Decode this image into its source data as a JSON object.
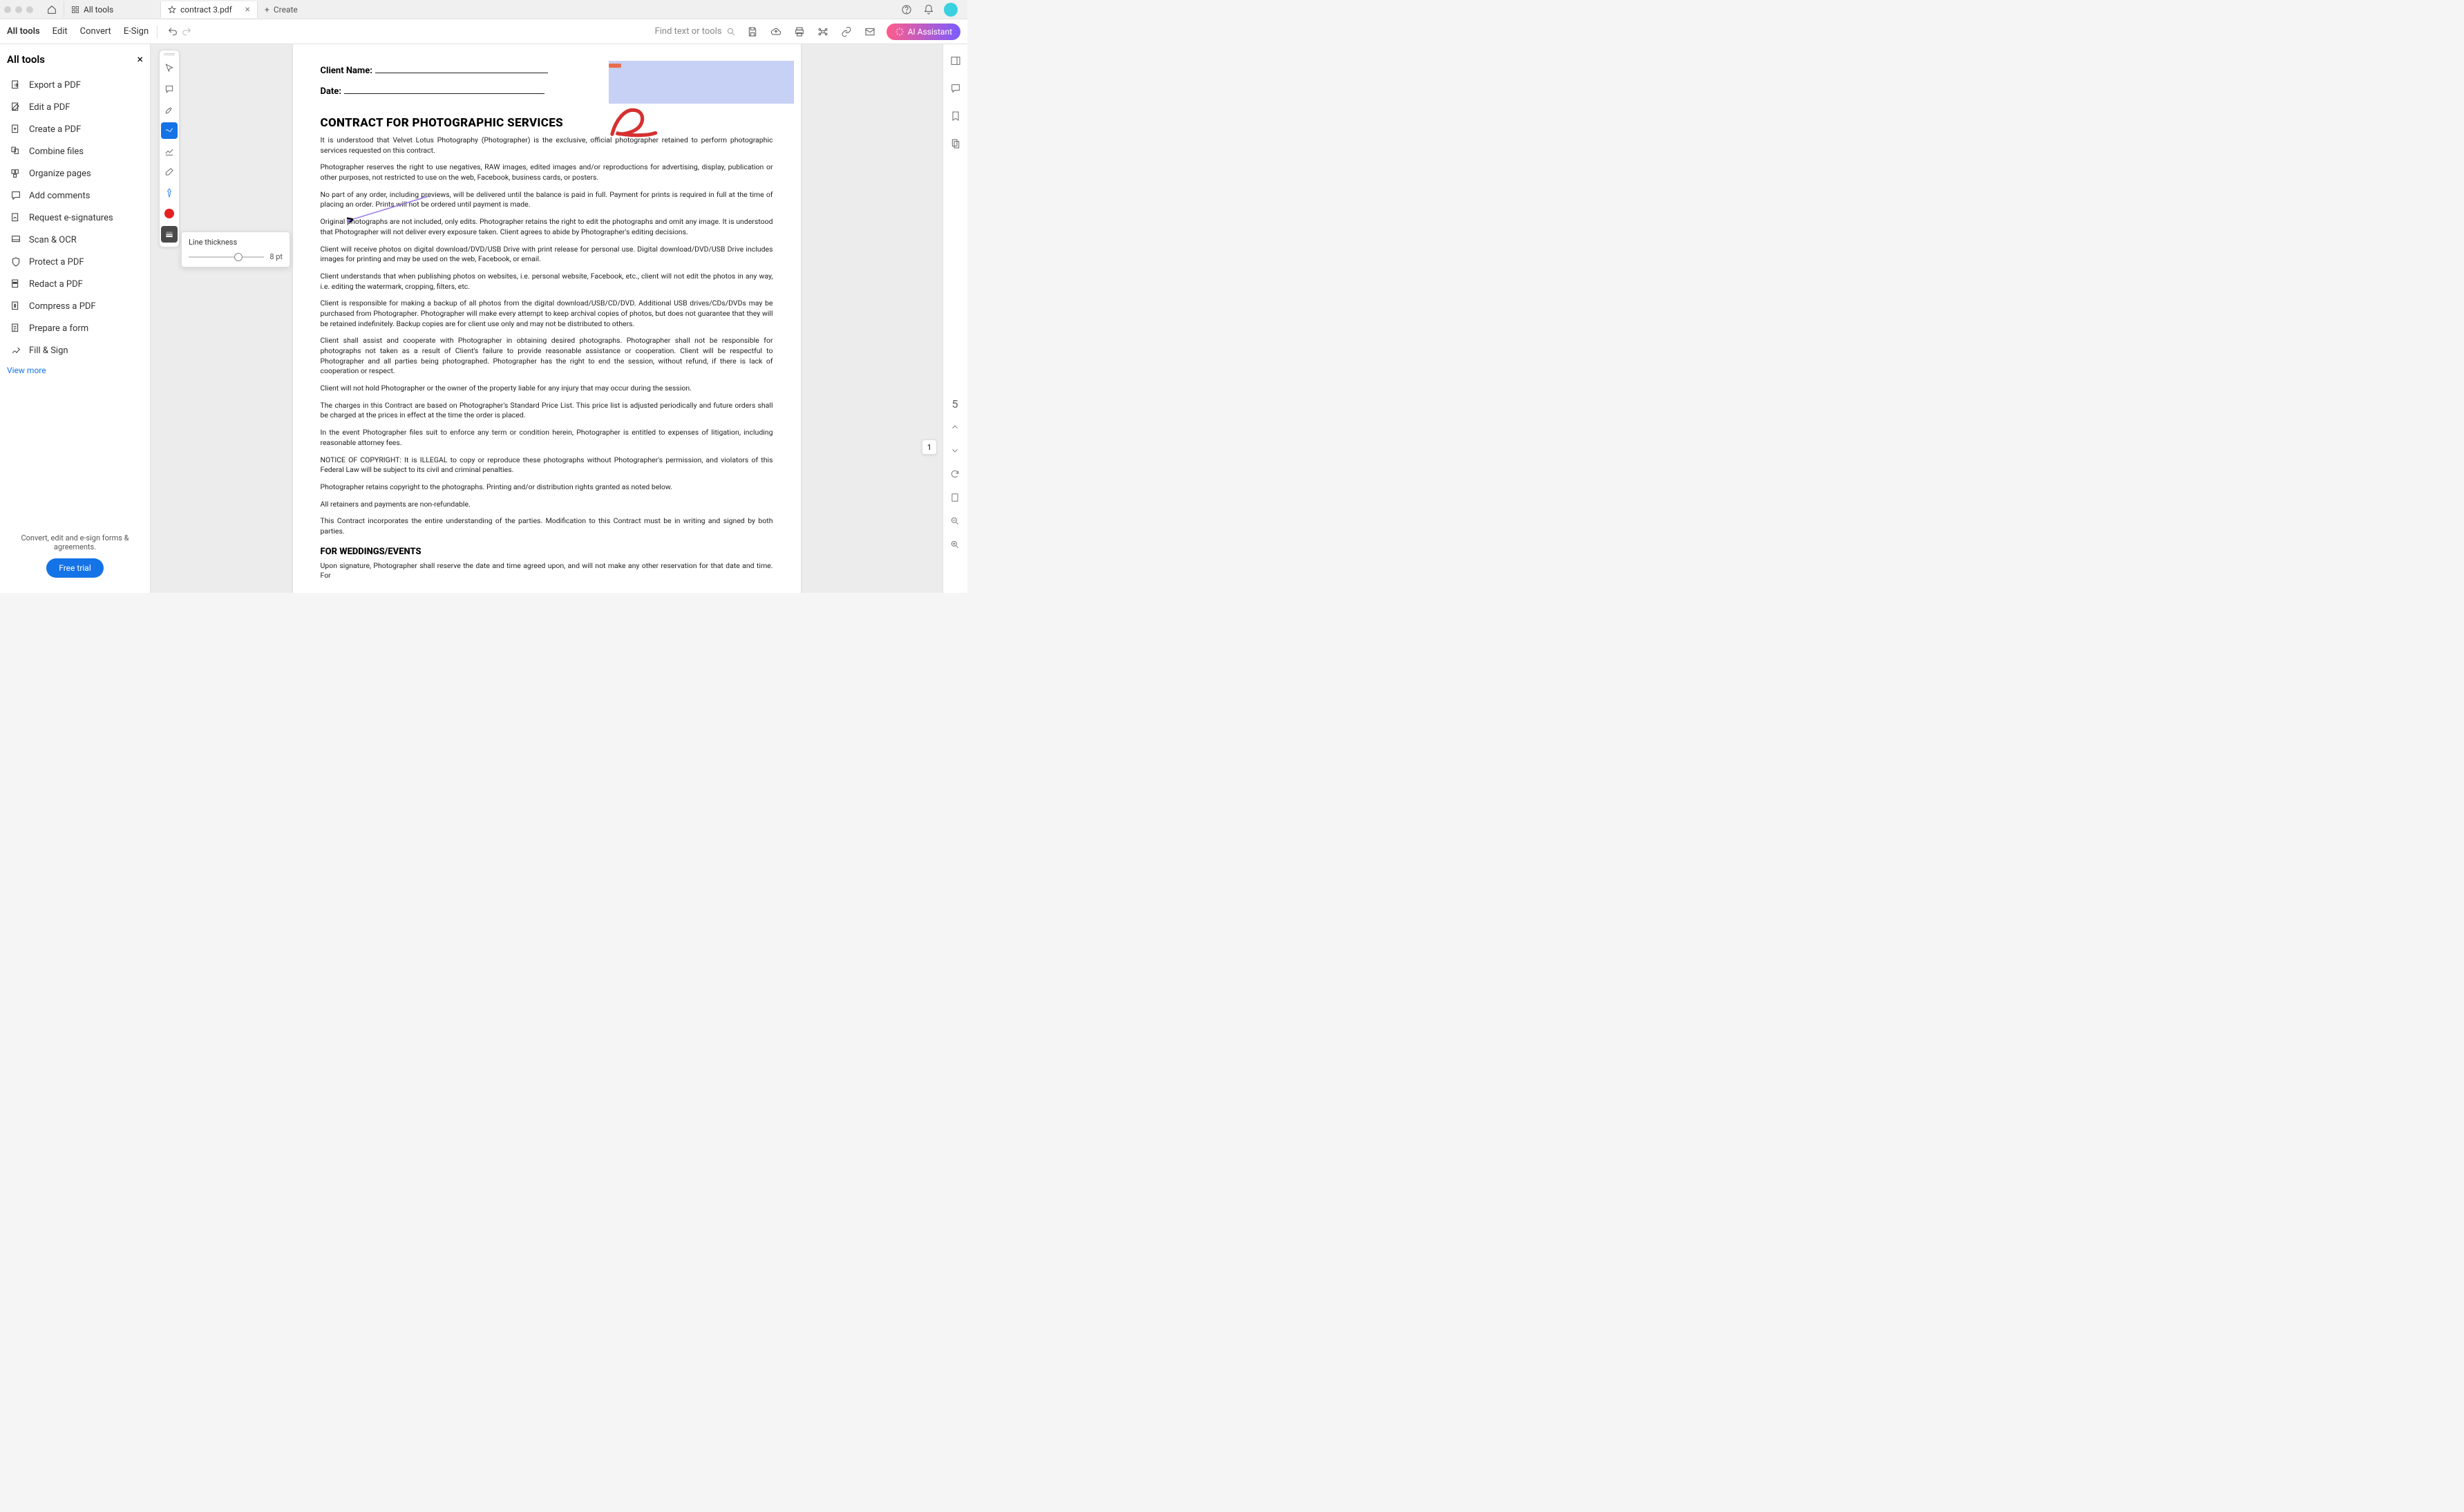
{
  "tabs": {
    "all_tools_tab": "All tools",
    "document_tab": "contract 3.pdf",
    "create_label": "Create"
  },
  "toolbar": {
    "menus": [
      "All tools",
      "Edit",
      "Convert",
      "E-Sign"
    ],
    "find_placeholder": "Find text or tools",
    "ai_label": "AI Assistant"
  },
  "left_panel": {
    "title": "All tools",
    "tools": [
      "Export a PDF",
      "Edit a PDF",
      "Create a PDF",
      "Combine files",
      "Organize pages",
      "Add comments",
      "Request e-signatures",
      "Scan & OCR",
      "Protect a PDF",
      "Redact a PDF",
      "Compress a PDF",
      "Prepare a form",
      "Fill & Sign"
    ],
    "view_more": "View more",
    "promo_text": "Convert, edit and e-sign forms & agreements.",
    "promo_cta": "Free trial"
  },
  "thickness": {
    "label": "Line thickness",
    "value": "8 pt"
  },
  "document": {
    "client_name_label": "Client Name:",
    "date_label": "Date:",
    "title": "CONTRACT FOR PHOTOGRAPHIC SERVICES",
    "paragraphs": [
      "It is understood that Velvet Lotus Photography (Photographer) is the exclusive, official photographer retained to perform photographic services requested on this contract.",
      "Photographer reserves the right to use negatives, RAW images, edited images and/or reproductions for advertising, display, publication or other purposes, not restricted to use on the web, Facebook, business cards, or posters.",
      "No part of any order, including previews, will be delivered until the balance is paid in full. Payment for prints is required in full at the time of placing an order. Prints will not be ordered until payment is made.",
      "Original photographs are not included, only edits. Photographer retains the right to edit the photographs and omit any image. It is understood that Photographer will not deliver every exposure taken. Client agrees to abide by Photographer's editing decisions.",
      "Client will receive photos on digital download/DVD/USB Drive with print release for personal use. Digital download/DVD/USB Drive includes images for printing and may be used on the web, Facebook, or email.",
      "Client understands that when publishing photos on websites, i.e. personal website, Facebook, etc., client will not edit the photos in any way, i.e. editing the watermark, cropping, filters, etc.",
      "Client is responsible for making a backup of all photos from the digital download/USB/CD/DVD. Additional USB drives/CDs/DVDs may be purchased from Photographer. Photographer will make every attempt to keep archival copies of photos, but does not guarantee that they will be retained indefinitely. Backup copies are for client use only and may not be distributed to others.",
      "Client shall assist and cooperate with Photographer in obtaining desired photographs. Photographer shall not be responsible for photographs not taken as a result of Client's failure to provide reasonable assistance or cooperation. Client will be respectful to Photographer and all parties being photographed. Photographer has the right to end the session, without refund, if there is lack of cooperation or respect.",
      "Client will not hold Photographer or the owner of the property liable for any injury that may occur during the session.",
      "The charges in this Contract are based on Photographer's Standard Price List. This price list is adjusted periodically and future orders shall be charged at the prices in effect at the time the order is placed.",
      "In the event Photographer files suit to enforce any term or condition herein, Photographer is entitled to expenses of litigation, including reasonable attorney fees.",
      "NOTICE OF COPYRIGHT: It is ILLEGAL to copy or reproduce these photographs without Photographer's permission, and violators of this Federal Law will be subject to its civil and criminal penalties.",
      "Photographer retains copyright to the photographs. Printing and/or distribution rights granted as noted below.",
      "All retainers and payments are non-refundable.",
      "This Contract incorporates the entire understanding of the parties. Modification to this Contract must be in writing and signed by both parties."
    ],
    "section2_title": "FOR WEDDINGS/EVENTS",
    "section2_para": "Upon signature, Photographer shall reserve the date and time agreed upon, and will not make any other reservation for that date and time. For"
  },
  "page_indicator": {
    "current": "1",
    "total": "5"
  }
}
